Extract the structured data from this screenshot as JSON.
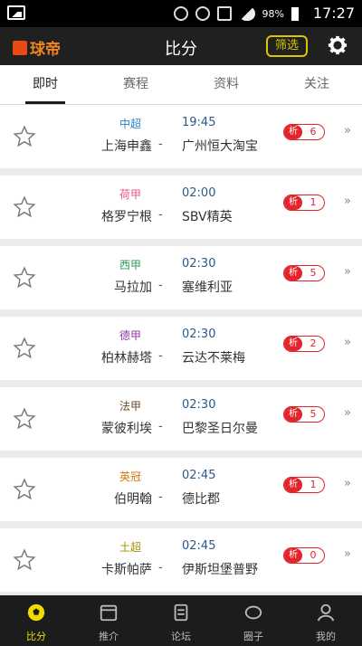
{
  "status_bar": {
    "battery": "98%",
    "time": "17:27",
    "icons": [
      "gallery-icon",
      "alarm-icon",
      "wifi-icon",
      "sim-icon",
      "signal-icon",
      "battery-icon"
    ]
  },
  "header": {
    "logo": "球帝",
    "title": "比分",
    "filter_label": "筛选",
    "settings_icon": "gear-icon"
  },
  "tabs": [
    {
      "label": "即时",
      "active": true
    },
    {
      "label": "赛程",
      "active": false
    },
    {
      "label": "资料",
      "active": false
    },
    {
      "label": "关注",
      "active": false
    }
  ],
  "matches": [
    {
      "league": "中超",
      "league_color": "#2f7fd0",
      "time": "19:45",
      "home": "上海申鑫",
      "away": "广州恒大淘宝",
      "badge_label": "析",
      "badge_count": "6"
    },
    {
      "league": "荷甲",
      "league_color": "#e05a8a",
      "time": "02:00",
      "home": "格罗宁根",
      "away": "SBV精英",
      "badge_label": "析",
      "badge_count": "1"
    },
    {
      "league": "西甲",
      "league_color": "#2f9a56",
      "time": "02:30",
      "home": "马拉加",
      "away": "塞维利亚",
      "badge_label": "析",
      "badge_count": "5"
    },
    {
      "league": "德甲",
      "league_color": "#8b3aa8",
      "time": "02:30",
      "home": "柏林赫塔",
      "away": "云达不莱梅",
      "badge_label": "析",
      "badge_count": "2"
    },
    {
      "league": "法甲",
      "league_color": "#6b4a2a",
      "time": "02:30",
      "home": "蒙彼利埃",
      "away": "巴黎圣日尔曼",
      "badge_label": "析",
      "badge_count": "5"
    },
    {
      "league": "英冠",
      "league_color": "#c97a12",
      "time": "02:45",
      "home": "伯明翰",
      "away": "德比郡",
      "badge_label": "析",
      "badge_count": "1"
    },
    {
      "league": "土超",
      "league_color": "#a38f00",
      "time": "02:45",
      "home": "卡斯帕萨",
      "away": "伊斯坦堡普野",
      "badge_label": "析",
      "badge_count": "0"
    }
  ],
  "match_dash": "-",
  "match_more": "»",
  "bottom_nav": [
    {
      "label": "比分",
      "icon": "soccer-ball-icon",
      "active": true
    },
    {
      "label": "推介",
      "icon": "calendar-icon",
      "active": false
    },
    {
      "label": "论坛",
      "icon": "forum-icon",
      "active": false
    },
    {
      "label": "圈子",
      "icon": "circle-icon",
      "active": false
    },
    {
      "label": "我的",
      "icon": "profile-icon",
      "active": false
    }
  ]
}
